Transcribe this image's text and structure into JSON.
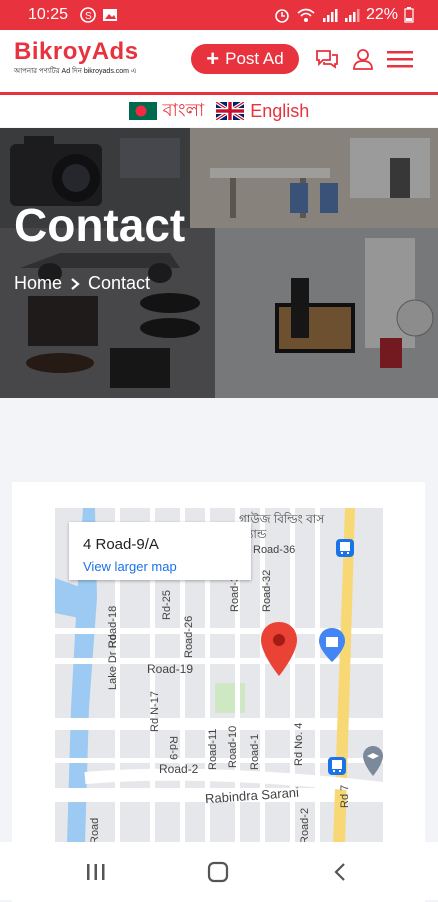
{
  "status_bar": {
    "time": "10:25",
    "battery": "22%"
  },
  "header": {
    "brand": "BikroyAds",
    "tagline": "আপনার পণ্যটির Ad দিন bikroyads.com এ",
    "post_ad_label": "Post Ad"
  },
  "languages": [
    {
      "label": "বাংলা",
      "flag": "bangladesh-flag-icon"
    },
    {
      "label": "English",
      "flag": "uk-flag-icon"
    }
  ],
  "hero": {
    "title": "Contact",
    "breadcrumb": [
      "Home",
      "Contact"
    ]
  },
  "map": {
    "address": "4 Road-9/A",
    "larger_map_link": "View larger map",
    "street_labels": [
      "Rabindra Sarani",
      "Road-19",
      "Road-2",
      "Road-18",
      "Lake Dr Rd",
      "Rd N-17",
      "Road-26",
      "Rd-25",
      "Road-30",
      "Road-32",
      "Road-36",
      "Road-10",
      "Road-11",
      "Road-1",
      "Rd No. 4",
      "Road-2",
      "Rd 7",
      "Road",
      "Rd-9"
    ],
    "poi_labels": [
      "গাউজ বিল্ডিং বাস স্ট্যান্ড"
    ]
  },
  "colors": {
    "accent": "#e8323e",
    "link": "#1a73e8"
  }
}
